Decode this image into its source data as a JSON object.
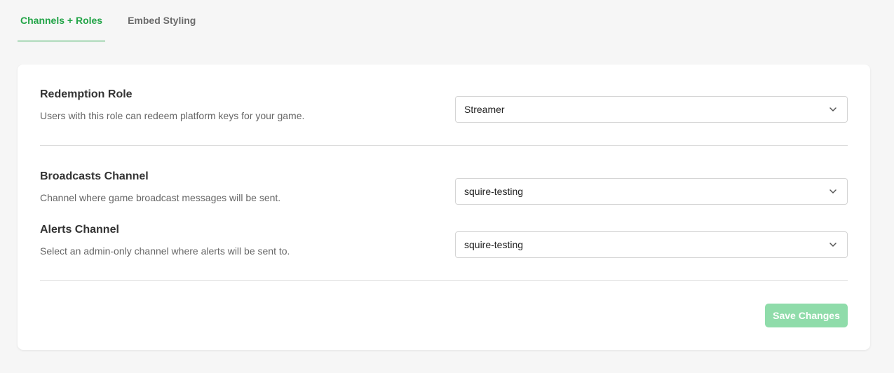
{
  "tabs": [
    {
      "label": "Channels + Roles",
      "active": true
    },
    {
      "label": "Embed Styling",
      "active": false
    }
  ],
  "redemption": {
    "label": "Redemption Role",
    "description": "Users with this role can redeem platform keys for your game.",
    "value": "Streamer"
  },
  "broadcasts": {
    "label": "Broadcasts Channel",
    "description": "Channel where game broadcast messages will be sent.",
    "value": "squire-testing"
  },
  "alerts": {
    "label": "Alerts Channel",
    "description": "Select an admin-only channel where alerts will be sent to.",
    "value": "squire-testing"
  },
  "save_label": "Save Changes",
  "colors": {
    "accent": "#22a447",
    "save_disabled": "#8fdcaa",
    "background": "#f6f6f6"
  },
  "icons": {
    "dropdown": "chevron-down-icon"
  }
}
